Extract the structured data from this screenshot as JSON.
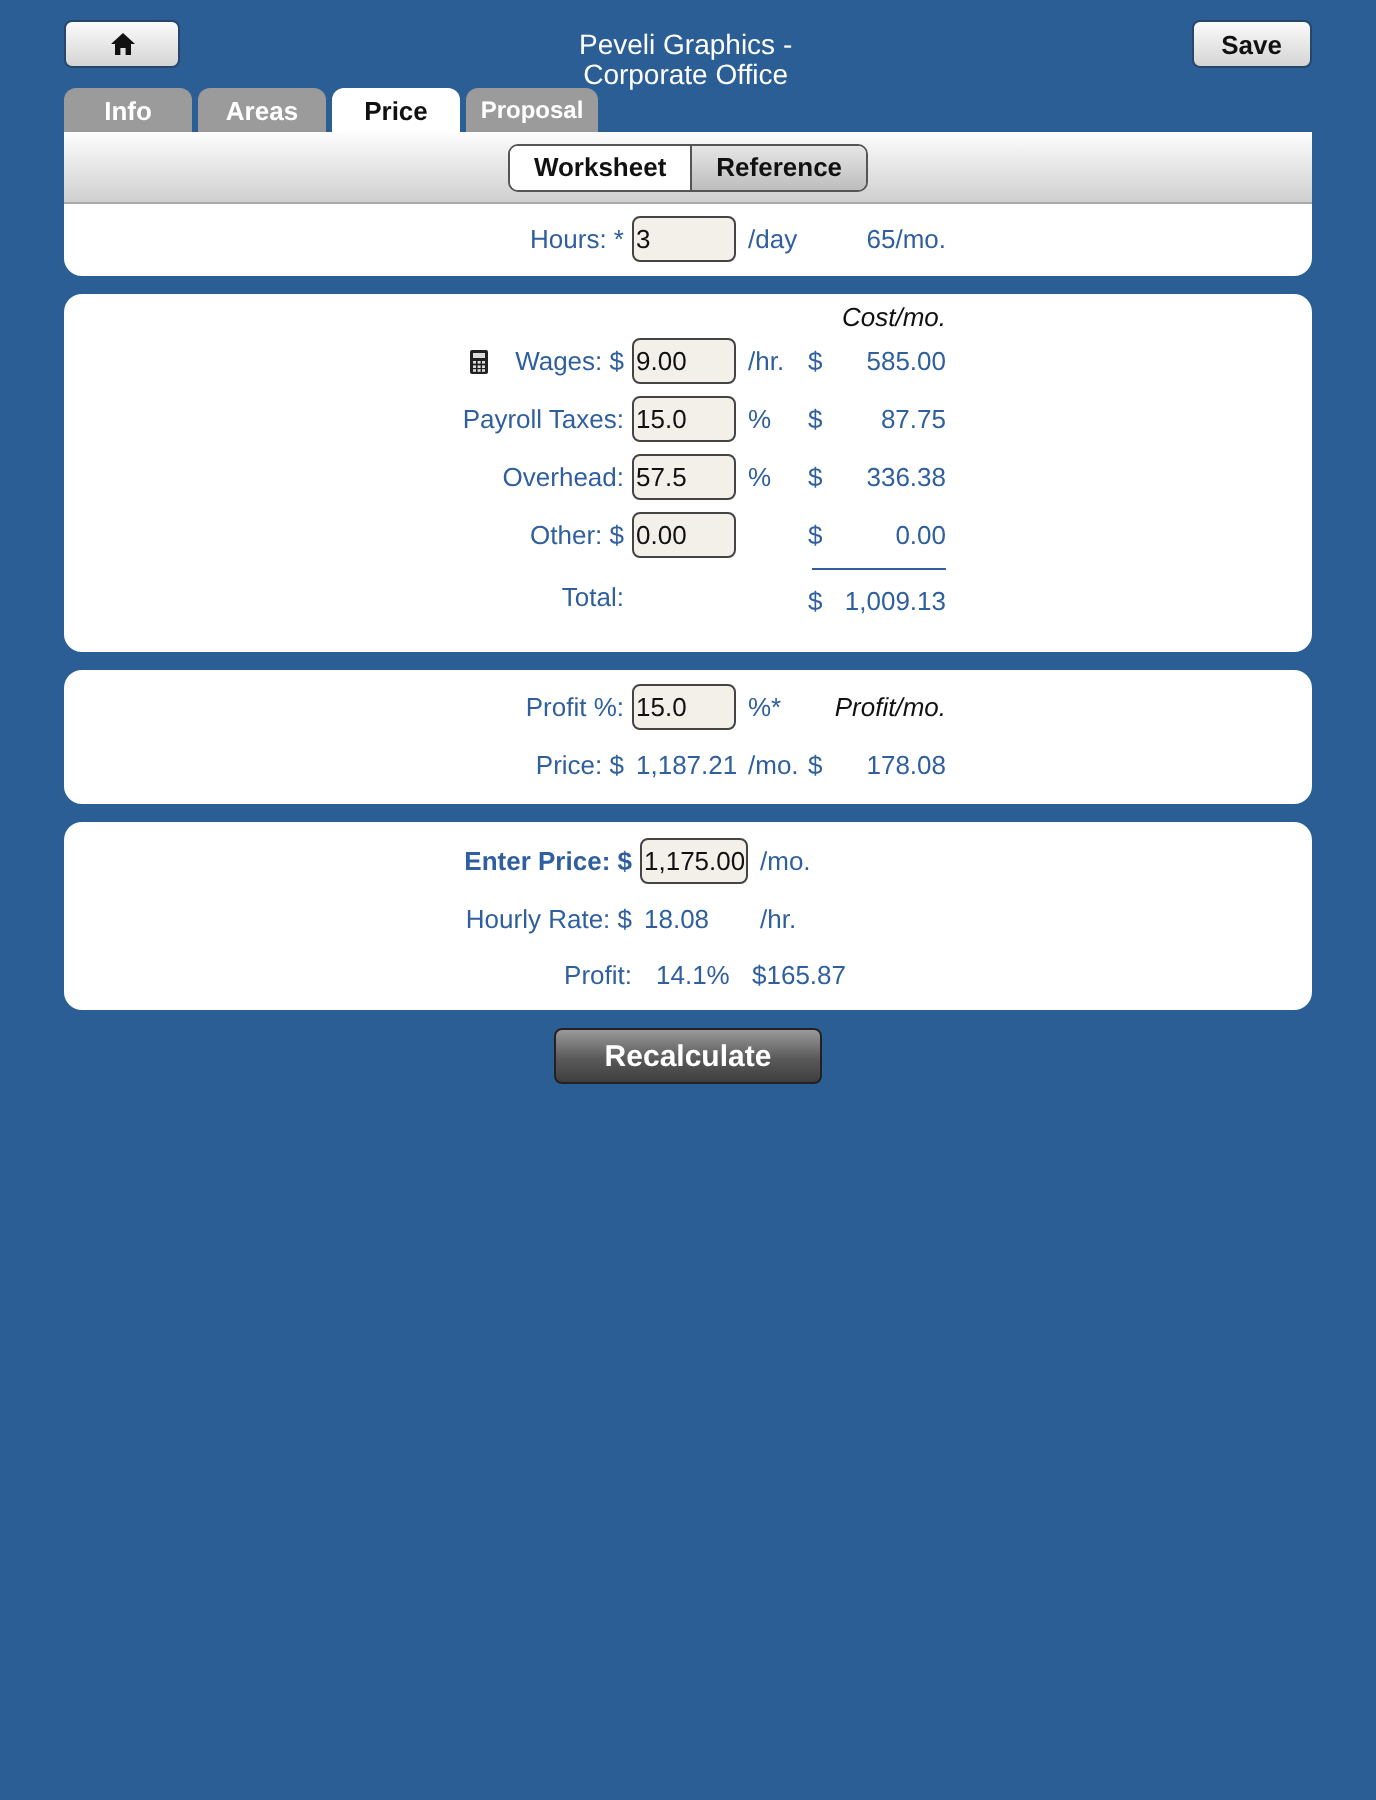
{
  "header": {
    "title": "Peveli Graphics - Corporate Office",
    "save_button": "Save"
  },
  "tabs": [
    {
      "label": "Info",
      "selected": false
    },
    {
      "label": "Areas",
      "selected": false
    },
    {
      "label": "Price",
      "selected": true
    },
    {
      "label": "Proposal",
      "selected": false
    }
  ],
  "segments": [
    {
      "label": "Worksheet",
      "selected": true
    },
    {
      "label": "Reference",
      "selected": false
    }
  ],
  "hours": {
    "label": "Hours: *",
    "value": "3",
    "unit": "/day",
    "monthly": "65/mo."
  },
  "costs": {
    "header": "Cost/mo.",
    "rows": [
      {
        "label": "Wages: $",
        "calculator": true,
        "value": "9.00",
        "unit": "/hr.",
        "currency": "$",
        "amount": "585.00"
      },
      {
        "label": "Payroll Taxes:",
        "calculator": false,
        "value": "15.0",
        "unit": "%",
        "currency": "$",
        "amount": "87.75"
      },
      {
        "label": "Overhead:",
        "calculator": false,
        "value": "57.5",
        "unit": "%",
        "currency": "$",
        "amount": "336.38"
      },
      {
        "label": "Other: $",
        "calculator": false,
        "value": "0.00",
        "currency": "$",
        "amount": "0.00"
      }
    ],
    "total": {
      "label": "Total:",
      "currency": "$",
      "amount": "1,009.13"
    }
  },
  "profit": {
    "label": "Profit %:",
    "value": "15.0",
    "unit": "%*",
    "header": "Profit/mo.",
    "price": {
      "label": "Price: $",
      "value": "1,187.21",
      "unit": "/mo.",
      "currency": "$",
      "amount": "178.08"
    }
  },
  "enter": {
    "price": {
      "label": "Enter Price: $",
      "value": "1,175.00",
      "unit": "/mo."
    },
    "hourly": {
      "label": "Hourly Rate: $",
      "value": "18.08",
      "unit": "/hr."
    },
    "profit": {
      "label": "Profit:",
      "percent": "14.1%",
      "amount": "$165.87"
    }
  },
  "action_button": "Recalculate"
}
